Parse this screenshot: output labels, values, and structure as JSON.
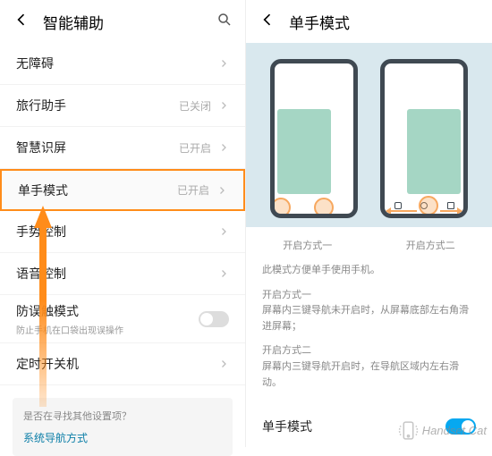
{
  "left": {
    "header": {
      "title": "智能辅助"
    },
    "rows": [
      {
        "label": "无障碍",
        "status": ""
      },
      {
        "label": "旅行助手",
        "status": "已关闭"
      },
      {
        "label": "智慧识屏",
        "status": "已开启"
      },
      {
        "label": "单手模式",
        "status": "已开启"
      },
      {
        "label": "手势控制",
        "status": ""
      },
      {
        "label": "语音控制",
        "status": ""
      },
      {
        "label": "防误触模式",
        "desc": "防止手机在口袋出现误操作"
      },
      {
        "label": "定时开关机",
        "status": ""
      }
    ],
    "hint": {
      "question": "是否在寻找其他设置项？",
      "link": "系统导航方式"
    }
  },
  "right": {
    "header": {
      "title": "单手模式"
    },
    "methods": {
      "one": "开启方式一",
      "two": "开启方式二"
    },
    "desc": {
      "intro": "此模式方便单手使用手机。",
      "m1_title": "开启方式一",
      "m1_body": "屏幕内三键导航未开启时，从屏幕底部左右角滑进屏幕；",
      "m2_title": "开启方式二",
      "m2_body": "屏幕内三键导航开启时，在导航区域内左右滑动。"
    },
    "toggle": {
      "label": "单手模式"
    }
  },
  "watermark": "Handset Cat"
}
